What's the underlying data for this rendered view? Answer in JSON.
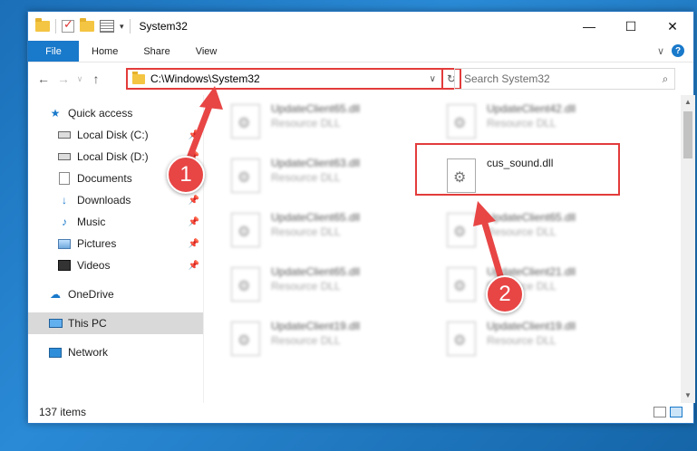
{
  "window": {
    "title": "System32",
    "controls": {
      "minimize": "—",
      "maximize": "☐",
      "close": "✕"
    }
  },
  "ribbon": {
    "file_tab": "File",
    "tabs": [
      "Home",
      "Share",
      "View"
    ],
    "collapse_glyph": "∨",
    "help_glyph": "?"
  },
  "address_bar": {
    "path": "C:\\Windows\\System32",
    "search_placeholder": "Search System32"
  },
  "sidebar": {
    "items": [
      {
        "label": "Quick access",
        "icon": "star-icon",
        "level": 1,
        "pinned": false
      },
      {
        "label": "Local Disk (C:)",
        "icon": "drive-icon",
        "level": 2,
        "pinned": true
      },
      {
        "label": "Local Disk (D:)",
        "icon": "drive-icon",
        "level": 2,
        "pinned": true
      },
      {
        "label": "Documents",
        "icon": "documents-icon",
        "level": 2,
        "pinned": true
      },
      {
        "label": "Downloads",
        "icon": "downloads-icon",
        "level": 2,
        "pinned": true
      },
      {
        "label": "Music",
        "icon": "music-icon",
        "level": 2,
        "pinned": true
      },
      {
        "label": "Pictures",
        "icon": "pictures-icon",
        "level": 2,
        "pinned": true
      },
      {
        "label": "Videos",
        "icon": "videos-icon",
        "level": 2,
        "pinned": true
      },
      {
        "label": "OneDrive",
        "icon": "cloud-icon",
        "level": 1,
        "pinned": false
      },
      {
        "label": "This PC",
        "icon": "computer-icon",
        "level": 1,
        "pinned": false,
        "selected": true
      },
      {
        "label": "Network",
        "icon": "network-icon",
        "level": 1,
        "pinned": false
      }
    ]
  },
  "files": [
    {
      "name": "UpdateClient65.dll",
      "type": "Resource DLL",
      "blurred": true
    },
    {
      "name": "UpdateClient42.dll",
      "type": "Resource DLL",
      "blurred": true
    },
    {
      "name": "UpdateClient63.dll",
      "type": "Resource DLL",
      "blurred": true
    },
    {
      "name": "cus_sound.dll",
      "type": "",
      "blurred": false,
      "highlighted": true
    },
    {
      "name": "UpdateClient65.dll",
      "type": "Resource DLL",
      "blurred": true
    },
    {
      "name": "UpdateClient65.dll",
      "type": "Resource DLL",
      "blurred": true
    },
    {
      "name": "UpdateClient65.dll",
      "type": "Resource DLL",
      "blurred": true
    },
    {
      "name": "UpdateClient21.dll",
      "type": "Resource DLL",
      "blurred": true
    },
    {
      "name": "UpdateClient19.dll",
      "type": "Resource DLL",
      "blurred": true
    },
    {
      "name": "UpdateClient19.dll",
      "type": "Resource DLL",
      "blurred": true
    }
  ],
  "status_bar": {
    "item_count": "137 items"
  },
  "annotations": {
    "badge_1": "1",
    "badge_2": "2",
    "color": "#e33b3b"
  }
}
